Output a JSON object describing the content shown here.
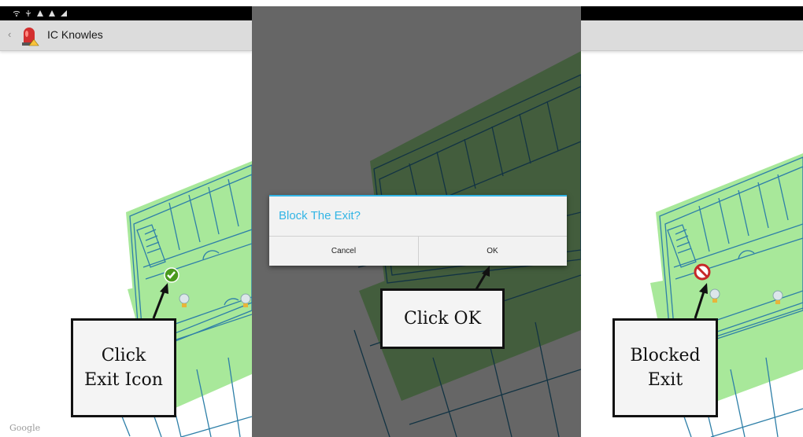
{
  "app": {
    "title": "IC Knowles",
    "back_glyph": "‹"
  },
  "status_icons": [
    "wifi-icon",
    "usb-icon",
    "warning-icon",
    "warning-icon",
    "signal-icon"
  ],
  "panels": [
    {
      "callout": [
        "Click",
        "Exit Icon"
      ],
      "exit_state": "open",
      "footer": "Google"
    },
    {
      "dialog": {
        "title": "Block The Exit?",
        "cancel_label": "Cancel",
        "ok_label": "OK"
      },
      "callout": [
        "Click OK"
      ]
    },
    {
      "callout": [
        "Blocked",
        "Exit"
      ],
      "exit_state": "blocked"
    }
  ],
  "colors": {
    "floor_fill": "#a8e89a",
    "wall_stroke": "#2e7fa8",
    "accent": "#33b5e5",
    "exit_ok": "#4a9a1e",
    "exit_blocked": "#c62828"
  }
}
